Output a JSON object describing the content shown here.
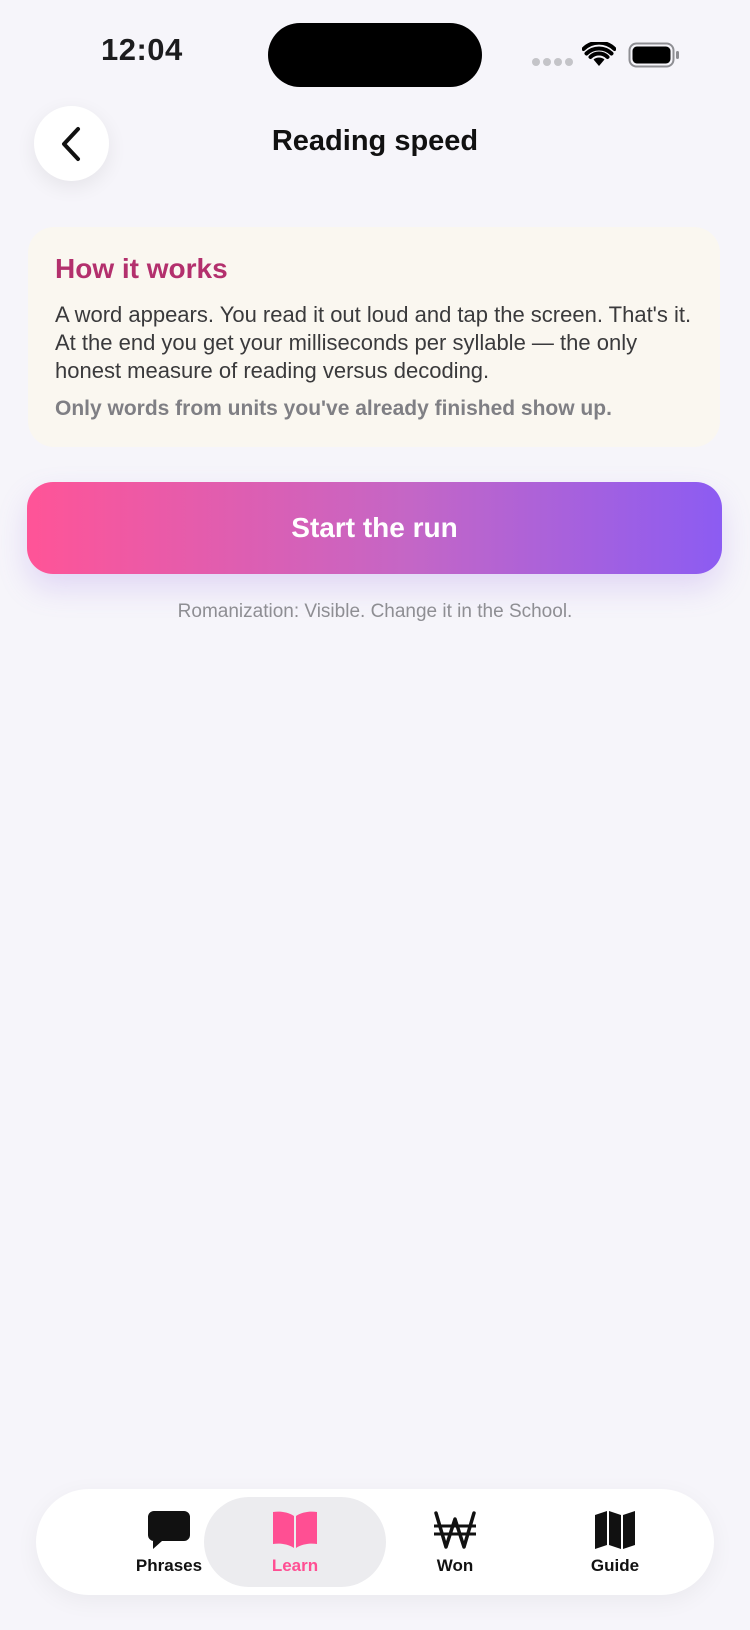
{
  "status_bar": {
    "time": "12:04"
  },
  "header": {
    "title": "Reading speed"
  },
  "info_card": {
    "heading": "How it works",
    "body": "A word appears. You read it out loud and tap the screen. That's it. At the end you get your milliseconds per syllable — the only honest measure of reading versus decoding.",
    "note": "Only words from units you've already finished show up."
  },
  "start_button": {
    "label": "Start the run"
  },
  "romanization_note": "Romanization: Visible. Change it in the School.",
  "tab_bar": {
    "active": "Learn",
    "accent_color": "#ff4f93",
    "items": [
      {
        "label": "Phrases",
        "icon": "speech-bubble-icon"
      },
      {
        "label": "Learn",
        "icon": "book-icon"
      },
      {
        "label": "Won",
        "icon": "won-currency-icon"
      },
      {
        "label": "Guide",
        "icon": "map-icon"
      }
    ]
  }
}
